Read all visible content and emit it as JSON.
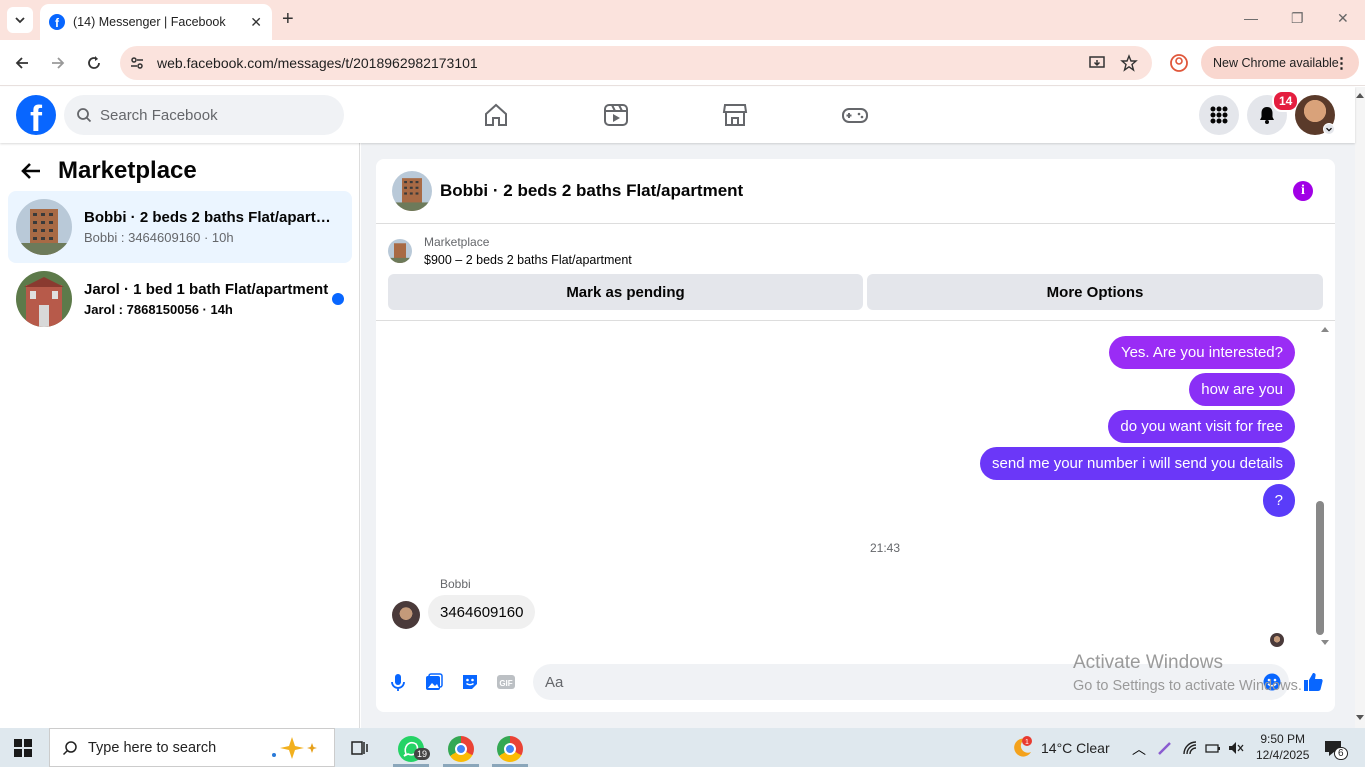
{
  "browser": {
    "tab_title": "(14) Messenger | Facebook",
    "url": "web.facebook.com/messages/t/2018962982173101",
    "new_chrome_label": "New Chrome available"
  },
  "header": {
    "search_placeholder": "Search Facebook",
    "notification_count": "14",
    "brand_color": "#0866ff"
  },
  "sidebar": {
    "title": "Marketplace",
    "conversations": [
      {
        "name": "Bobbi · 2 beds 2 baths Flat/apartm...",
        "preview": "Bobbi : 3464609160 · 10h"
      },
      {
        "name": "Jarol · 1 bed 1 bath Flat/apartment",
        "preview": "Jarol : 7868150056 · 14h"
      }
    ]
  },
  "chat": {
    "title": "Bobbi · 2 beds 2 baths Flat/apartment",
    "listing_label": "Marketplace",
    "listing_price": "$900 – 2 beds 2 baths Flat/apartment",
    "mark_pending_label": "Mark as pending",
    "more_options_label": "More Options",
    "messages_out": [
      {
        "text": "Yes. Are you interested?"
      },
      {
        "text": "how are you"
      },
      {
        "text": "do you want visit for free"
      },
      {
        "text": "send me your number i will send you details"
      },
      {
        "text": "?"
      }
    ],
    "timestamp": "21:43",
    "incoming_sender": "Bobbi",
    "incoming_message": "3464609160",
    "composer_placeholder": "Aa",
    "gradient_top": "#a033ff",
    "gradient_bottom": "#3b5bff"
  },
  "watermark": {
    "line1": "Activate Windows",
    "line2": "Go to Settings to activate Windows."
  },
  "taskbar": {
    "search_placeholder": "Type here to search",
    "whatsapp_badge": "19",
    "weather": "14°C  Clear",
    "time": "9:50 PM",
    "date": "12/4/2025",
    "notification_count": "6"
  }
}
